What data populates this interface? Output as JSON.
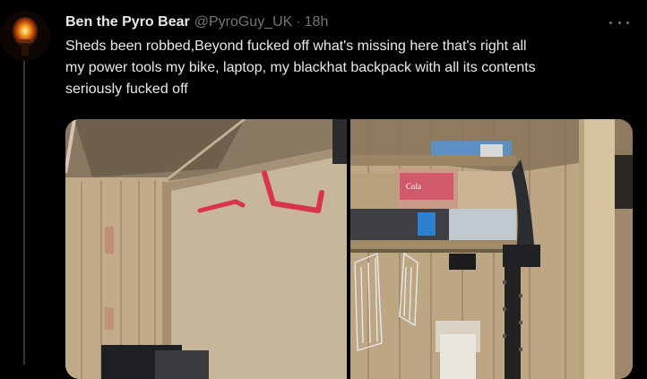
{
  "tweet": {
    "display_name": "Ben the Pyro Bear",
    "handle": "@PyroGuy_UK",
    "separator": "·",
    "timestamp": "18h",
    "text": "Sheds been robbed,Beyond fucked off what's missing here that's right all\nmy power tools my bike, laptop, my blackhat backpack with all its contents\nseriously fucked off",
    "more_icon": "more-horizontal-icon"
  },
  "media": {
    "photos": [
      {
        "name": "shed-wall-with-empty-hooks"
      },
      {
        "name": "shed-shelves-and-hedge-trimmer",
        "label_text": "Cola"
      }
    ]
  },
  "colors": {
    "background": "#000000",
    "text_primary": "#e7e9ea",
    "text_secondary": "#71767b",
    "thread_line": "#333639"
  }
}
